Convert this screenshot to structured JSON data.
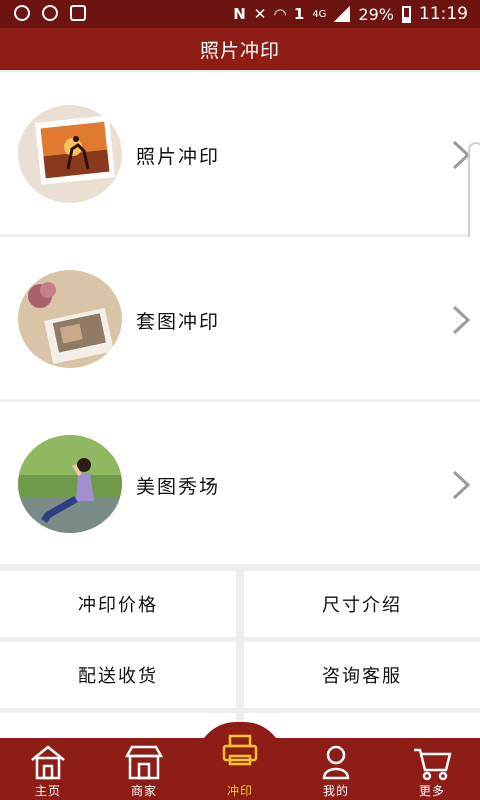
{
  "status_bar": {
    "battery": "29%",
    "time": "11:19",
    "network": "4G",
    "sim_label": "1",
    "nfc_label": "N"
  },
  "header": {
    "title": "照片冲印"
  },
  "list": [
    {
      "label": "照片冲印",
      "image": "couple-sunset-photo"
    },
    {
      "label": "套图冲印",
      "image": "photo-album-prints"
    },
    {
      "label": "美图秀场",
      "image": "girl-sitting-portrait"
    }
  ],
  "grid": [
    {
      "label": "冲印价格"
    },
    {
      "label": "尺寸介绍"
    },
    {
      "label": "配送收货"
    },
    {
      "label": "咨询客服"
    }
  ],
  "bottom_nav": [
    {
      "label": "主页",
      "icon": "home-icon"
    },
    {
      "label": "商家",
      "icon": "store-icon"
    },
    {
      "label": "冲印",
      "icon": "printer-icon",
      "active": true
    },
    {
      "label": "我的",
      "icon": "person-icon"
    },
    {
      "label": "更多",
      "icon": "cart-icon"
    }
  ],
  "colors": {
    "status_bar": "#6e1410",
    "header": "#8e1d15",
    "nav_active": "#f6c230",
    "background": "#eeeeee"
  }
}
